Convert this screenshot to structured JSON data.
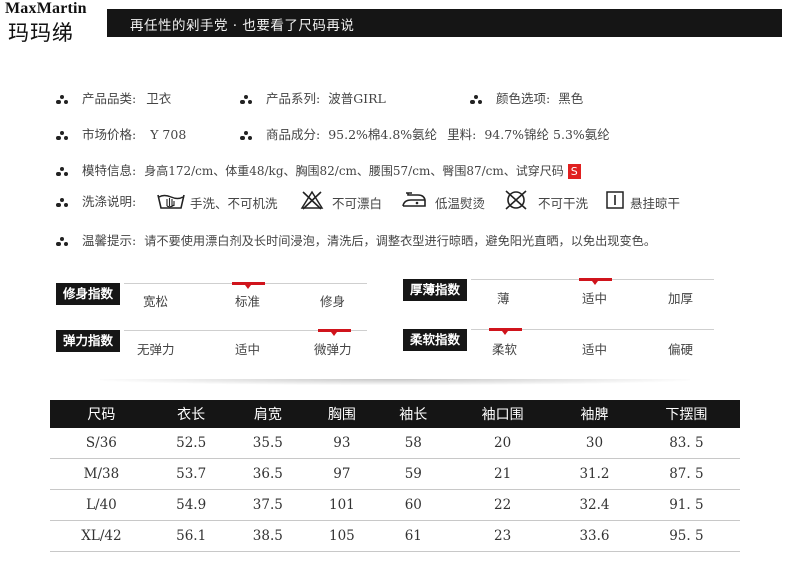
{
  "brand": {
    "name_en": "MaxMartin",
    "name_cn": "玛玛绨"
  },
  "header": {
    "slogan": "再任性的剁手党 · 也要看了尺码再说"
  },
  "info": {
    "category_label": "产品品类:",
    "category_value": "卫衣",
    "series_label": "产品系列:",
    "series_value": "波普GIRL",
    "color_label": "颜色选项:",
    "color_value": "黑色",
    "price_label": "市场价格:",
    "price_value": "Y 708",
    "material_label": "商品成分:",
    "material_value": "95.2%棉4.8%氨纶",
    "lining_label": "里料:",
    "lining_value": "94.7%锦纶 5.3%氨纶",
    "model_label": "模特信息:",
    "model_value": "身高172/cm、体重48/kg、胸围82/cm、腰围57/cm、臀围87/cm、试穿尺码",
    "model_size": "S",
    "wash_label": "洗涤说明:",
    "wash_items": [
      "手洗、不可机洗",
      "不可漂白",
      "低温熨烫",
      "不可干洗",
      "悬挂晾干"
    ],
    "tips_label": "温馨提示:",
    "tips_value": "请不要使用漂白剂及长时间浸泡，清洗后，调整衣型进行晾晒，避免阳光直晒，以免出现变色。"
  },
  "indices": [
    {
      "label": "修身指数",
      "options": [
        "宽松",
        "标准",
        "修身"
      ],
      "selected": "标准"
    },
    {
      "label": "厚薄指数",
      "options": [
        "薄",
        "适中",
        "加厚"
      ],
      "selected": "适中"
    },
    {
      "label": "弹力指数",
      "options": [
        "无弹力",
        "适中",
        "微弹力"
      ],
      "selected": "微弹力"
    },
    {
      "label": "柔软指数",
      "options": [
        "柔软",
        "适中",
        "偏硬"
      ],
      "selected": "柔软"
    }
  ],
  "size_table": {
    "headers": [
      "尺码",
      "衣长",
      "肩宽",
      "胸围",
      "袖长",
      "袖口围",
      "袖脾",
      "下摆围"
    ],
    "rows": [
      [
        "S/36",
        "52.5",
        "35.5",
        "93",
        "58",
        "20",
        "30",
        "83. 5"
      ],
      [
        "M/38",
        "53.7",
        "36.5",
        "97",
        "59",
        "21",
        "31.2",
        "87. 5"
      ],
      [
        "L/40",
        "54.9",
        "37.5",
        "101",
        "60",
        "22",
        "32.4",
        "91. 5"
      ],
      [
        "XL/42",
        "56.1",
        "38.5",
        "105",
        "61",
        "23",
        "33.6",
        "95. 5"
      ]
    ]
  },
  "colors": {
    "accent": "#d0141c",
    "dark": "#151515"
  }
}
